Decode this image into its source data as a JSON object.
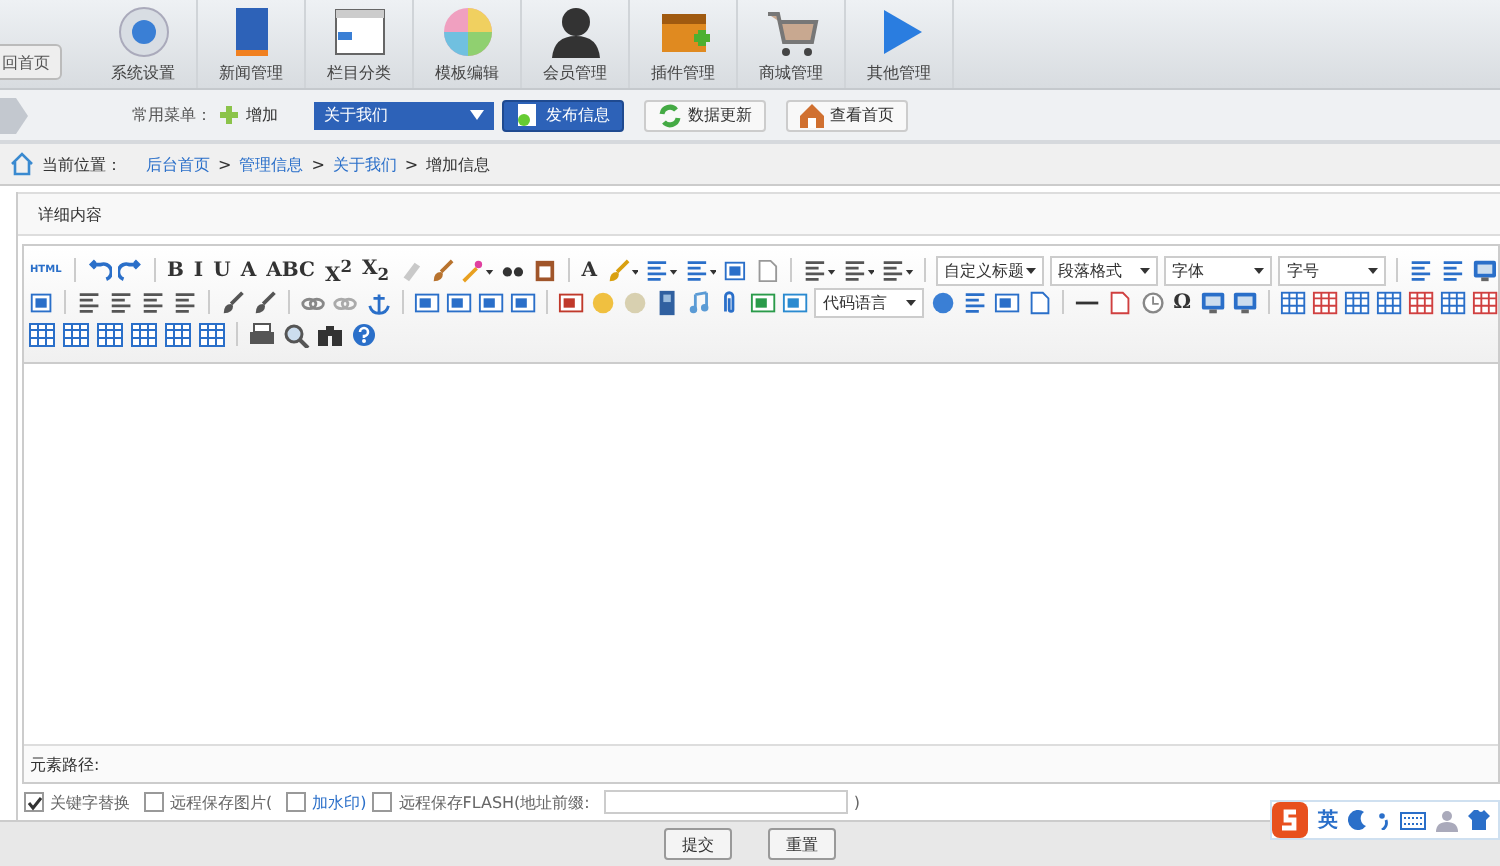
{
  "nav": {
    "back_button": "回首页",
    "items": [
      {
        "label": "系统设置"
      },
      {
        "label": "新闻管理"
      },
      {
        "label": "栏目分类"
      },
      {
        "label": "模板编辑"
      },
      {
        "label": "会员管理"
      },
      {
        "label": "插件管理"
      },
      {
        "label": "商城管理"
      },
      {
        "label": "其他管理"
      }
    ]
  },
  "quickbar": {
    "label": "常用菜单：",
    "add": "增加",
    "select": "关于我们",
    "buttons": [
      "发布信息",
      "数据更新",
      "查看首页"
    ]
  },
  "breadcrumb": {
    "label": "当前位置：",
    "items": [
      {
        "kind": "link",
        "text": "后台首页"
      },
      {
        "kind": "sep",
        "text": ">"
      },
      {
        "kind": "link",
        "text": "管理信息"
      },
      {
        "kind": "sep",
        "text": ">"
      },
      {
        "kind": "link",
        "text": "关于我们"
      },
      {
        "kind": "sep",
        "text": ">"
      },
      {
        "kind": "current",
        "text": "增加信息"
      }
    ]
  },
  "panel_title": "详细内容",
  "toolbar": [
    [
      {
        "kind": "glyph",
        "text": "HTML"
      },
      {
        "kind": "sep"
      },
      {
        "kind": "icon"
      },
      {
        "kind": "icon"
      },
      {
        "kind": "sep"
      },
      {
        "kind": "glyph",
        "text": "B"
      },
      {
        "kind": "glyph",
        "text": "I"
      },
      {
        "kind": "glyph",
        "text": "U"
      },
      {
        "kind": "glyph",
        "text": "A"
      },
      {
        "kind": "glyph",
        "text": "ABC"
      },
      {
        "kind": "glyph",
        "text": "X$^{2}$"
      },
      {
        "kind": "glyph",
        "text": "X$_{2}$"
      },
      {
        "kind": "icon"
      },
      {
        "kind": "icon"
      },
      {
        "kind": "icon"
      },
      {
        "kind": "icon"
      },
      {
        "kind": "icon"
      },
      {
        "kind": "sep"
      },
      {
        "kind": "glyph",
        "text": "A"
      },
      {
        "kind": "icon"
      },
      {
        "kind": "icon"
      },
      {
        "kind": "icon"
      },
      {
        "kind": "icon"
      },
      {
        "kind": "icon"
      },
      {
        "kind": "sep"
      },
      {
        "kind": "icon"
      },
      {
        "kind": "icon"
      },
      {
        "kind": "icon"
      },
      {
        "kind": "sep"
      },
      {
        "kind": "select",
        "text": "自定义标题"
      },
      {
        "kind": "select",
        "text": "段落格式"
      },
      {
        "kind": "select",
        "text": "字体"
      },
      {
        "kind": "select",
        "text": "字号"
      },
      {
        "kind": "sep"
      },
      {
        "kind": "icon"
      },
      {
        "kind": "icon"
      },
      {
        "kind": "icon"
      }
    ],
    [
      {
        "kind": "icon"
      },
      {
        "kind": "sep"
      },
      {
        "kind": "icon"
      },
      {
        "kind": "icon"
      },
      {
        "kind": "icon"
      },
      {
        "kind": "icon"
      },
      {
        "kind": "sep"
      },
      {
        "kind": "icon"
      },
      {
        "kind": "icon"
      },
      {
        "kind": "sep"
      },
      {
        "kind": "icon"
      },
      {
        "kind": "icon"
      },
      {
        "kind": "icon"
      },
      {
        "kind": "sep"
      },
      {
        "kind": "icon"
      },
      {
        "kind": "icon"
      },
      {
        "kind": "icon"
      },
      {
        "kind": "icon"
      },
      {
        "kind": "sep"
      },
      {
        "kind": "icon"
      },
      {
        "kind": "icon"
      },
      {
        "kind": "icon"
      },
      {
        "kind": "icon"
      },
      {
        "kind": "icon"
      },
      {
        "kind": "icon"
      },
      {
        "kind": "icon"
      },
      {
        "kind": "icon"
      },
      {
        "kind": "select",
        "text": "代码语言"
      },
      {
        "kind": "icon"
      },
      {
        "kind": "icon"
      },
      {
        "kind": "icon"
      },
      {
        "kind": "icon"
      },
      {
        "kind": "sep"
      },
      {
        "kind": "icon"
      },
      {
        "kind": "icon"
      },
      {
        "kind": "icon"
      },
      {
        "kind": "glyph",
        "text": "Ω"
      },
      {
        "kind": "icon"
      },
      {
        "kind": "icon"
      },
      {
        "kind": "sep"
      },
      {
        "kind": "icon"
      },
      {
        "kind": "icon"
      },
      {
        "kind": "icon"
      },
      {
        "kind": "icon"
      },
      {
        "kind": "icon"
      },
      {
        "kind": "icon"
      },
      {
        "kind": "icon"
      }
    ],
    [
      {
        "kind": "icon"
      },
      {
        "kind": "icon"
      },
      {
        "kind": "icon"
      },
      {
        "kind": "icon"
      },
      {
        "kind": "icon"
      },
      {
        "kind": "icon"
      },
      {
        "kind": "sep"
      },
      {
        "kind": "icon"
      },
      {
        "kind": "icon"
      },
      {
        "kind": "icon"
      },
      {
        "kind": "icon"
      }
    ]
  ],
  "element_path": "元素路径:",
  "options": [
    {
      "kind": "checkbox",
      "label": "关键字替换",
      "checked": true
    },
    {
      "kind": "checkbox",
      "label": "远程保存图片(",
      "checked": false
    },
    {
      "kind": "checkbox-link",
      "label": "加水印)",
      "checked": false
    },
    {
      "kind": "checkbox",
      "label": "远程保存FLASH(地址前缀:",
      "checked": false
    },
    {
      "kind": "field"
    },
    {
      "kind": "text",
      "label": ")"
    }
  ],
  "buttons": [
    "提交",
    "重置"
  ],
  "ime": {
    "label": "英"
  }
}
